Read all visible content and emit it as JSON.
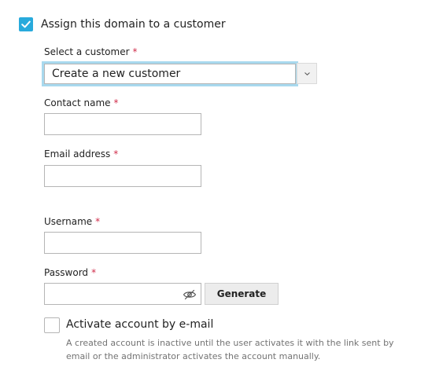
{
  "assign": {
    "label": "Assign this domain to a customer",
    "checked": true
  },
  "customer": {
    "label": "Select a customer",
    "required_mark": "*",
    "selected": "Create a new customer"
  },
  "contact_name": {
    "label": "Contact name",
    "required_mark": "*",
    "value": ""
  },
  "email": {
    "label": "Email address",
    "required_mark": "*",
    "value": ""
  },
  "username": {
    "label": "Username",
    "required_mark": "*",
    "value": ""
  },
  "password": {
    "label": "Password",
    "required_mark": "*",
    "value": "",
    "toggle_icon": "eye-slash-icon",
    "generate_label": "Generate"
  },
  "activate": {
    "label": "Activate account by e-mail",
    "checked": false,
    "help": "A created account is inactive until the user activates it with the link sent by email or the administrator activates the account manually."
  },
  "colors": {
    "accent": "#28aadc",
    "required": "#d02d4b",
    "focus_ring": "#a8d9ee",
    "help_text": "#737373"
  }
}
